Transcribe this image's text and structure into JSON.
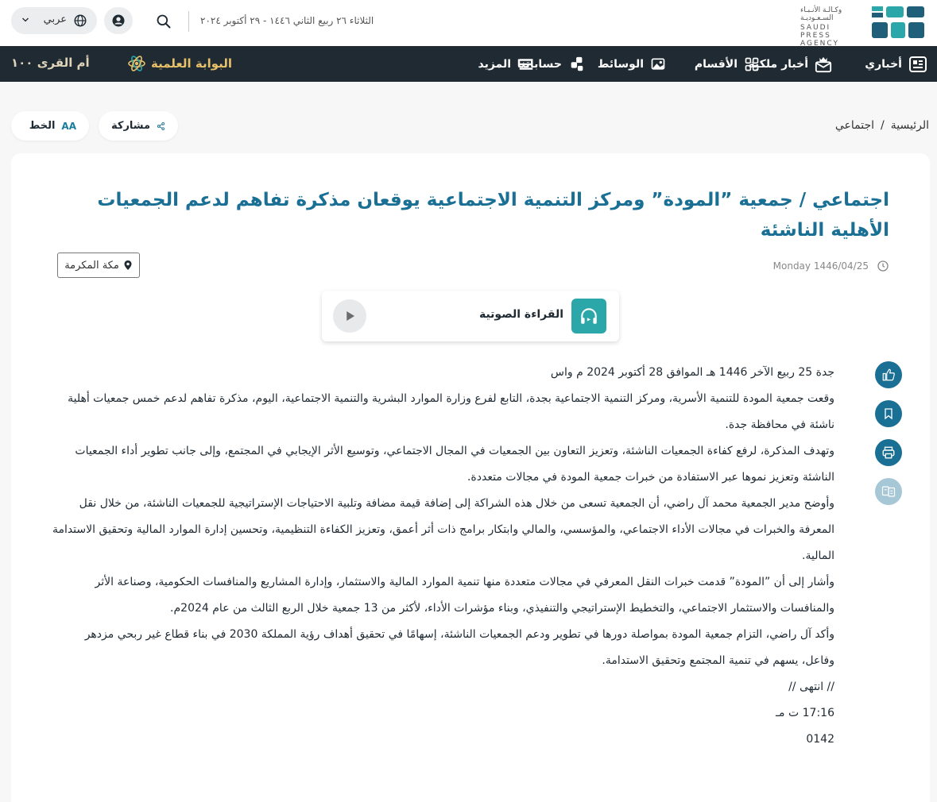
{
  "header": {
    "logo": {
      "ar_text": "وكـالـة الأنـبـاء السـعـوديـة",
      "en_text": "SAUDI PRESS AGENCY"
    },
    "date": "الثلاثاء ٢٦ ربيع الثاني ١٤٤٦ - ٢٩ أكتوبر ٢٠٢٤",
    "language": "عربي"
  },
  "nav": {
    "items": [
      "أخباري",
      "أخبار ملكية",
      "الأقسام",
      "الوسائط",
      "حساباتنا",
      "المزيد"
    ],
    "brand_bawaba": "البوابة العلمية",
    "brand_umm": "أم القرى ١٠٠"
  },
  "breadcrumb": {
    "home": "الرئيسية",
    "separator": "/",
    "current": "اجتماعي"
  },
  "actions": {
    "share": "مشاركة",
    "font": "الخط",
    "font_icon_text": "AA"
  },
  "article": {
    "title": "اجتماعي / جمعية ”المودة” ومركز التنمية الاجتماعية يوقعان مذكرة تفاهم لدعم الجمعيات الأهلية الناشئة",
    "date": "Monday 1446/04/25",
    "location": "مكة المكرمة",
    "audio_label": "القراءة الصوتية",
    "paragraphs": [
      "جدة 25 ربيع الآخر 1446 هـ الموافق 28 أكتوبر 2024 م واس",
      "وقعت جمعية المودة للتنمية الأسرية، ومركز التنمية الاجتماعية بجدة، التابع لفرع وزارة الموارد البشرية والتنمية الاجتماعية، اليوم، مذكرة تفاهم لدعم خمس جمعيات أهلية ناشئة في محافظة جدة.",
      "وتهدف المذكرة، لرفع كفاءة الجمعيات الناشئة، وتعزيز التعاون بين الجمعيات في المجال الاجتماعي، وتوسيع الأثر الإيجابي في المجتمع، وإلى جانب تطوير أداء الجمعيات الناشئة وتعزيز نموها عبر الاستفادة من خبرات جمعية المودة في مجالات متعددة.",
      "وأوضح مدير الجمعية محمد آل راضي، أن الجمعية تسعى من خلال هذه الشراكة إلى إضافة قيمة مضافة وتلبية الاحتياجات الإستراتيجية للجمعيات الناشئة، من خلال نقل المعرفة والخبرات في مجالات الأداء الاجتماعي، والمؤسسي، والمالي وابتكار برامج ذات أثر أعمق، وتعزيز الكفاءة التنظيمية، وتحسين إدارة الموارد المالية وتحقيق الاستدامة المالية.",
      "وأشار إلى أن ”المودة” قدمت خبرات النقل المعرفي في مجالات متعددة منها تنمية الموارد المالية والاستثمار، وإدارة المشاريع والمنافسات الحكومية، وصناعة الأثر والمنافسات والاستثمار الاجتماعي، والتخطيط الإستراتيجي والتنفيذي، وبناء مؤشرات الأداء، لأكثر من 13 جمعية خلال الربع الثالث من عام 2024م.",
      "وأكد آل راضي، التزام جمعية المودة بمواصلة دورها في تطوير ودعم الجمعيات الناشئة، إسهامًا في تحقيق أهداف رؤية المملكة 2030 في بناء قطاع غير ربحي مزدهر وفاعل، يسهم في تنمية المجتمع وتحقيق الاستدامة.",
      "// انتهى //",
      "17:16 ت مـ",
      "0142"
    ]
  },
  "colors": {
    "navbar": "#1f2a33",
    "title": "#1a6f94",
    "accent_teal": "#2ba6a9",
    "gold": "#e8c06a"
  }
}
